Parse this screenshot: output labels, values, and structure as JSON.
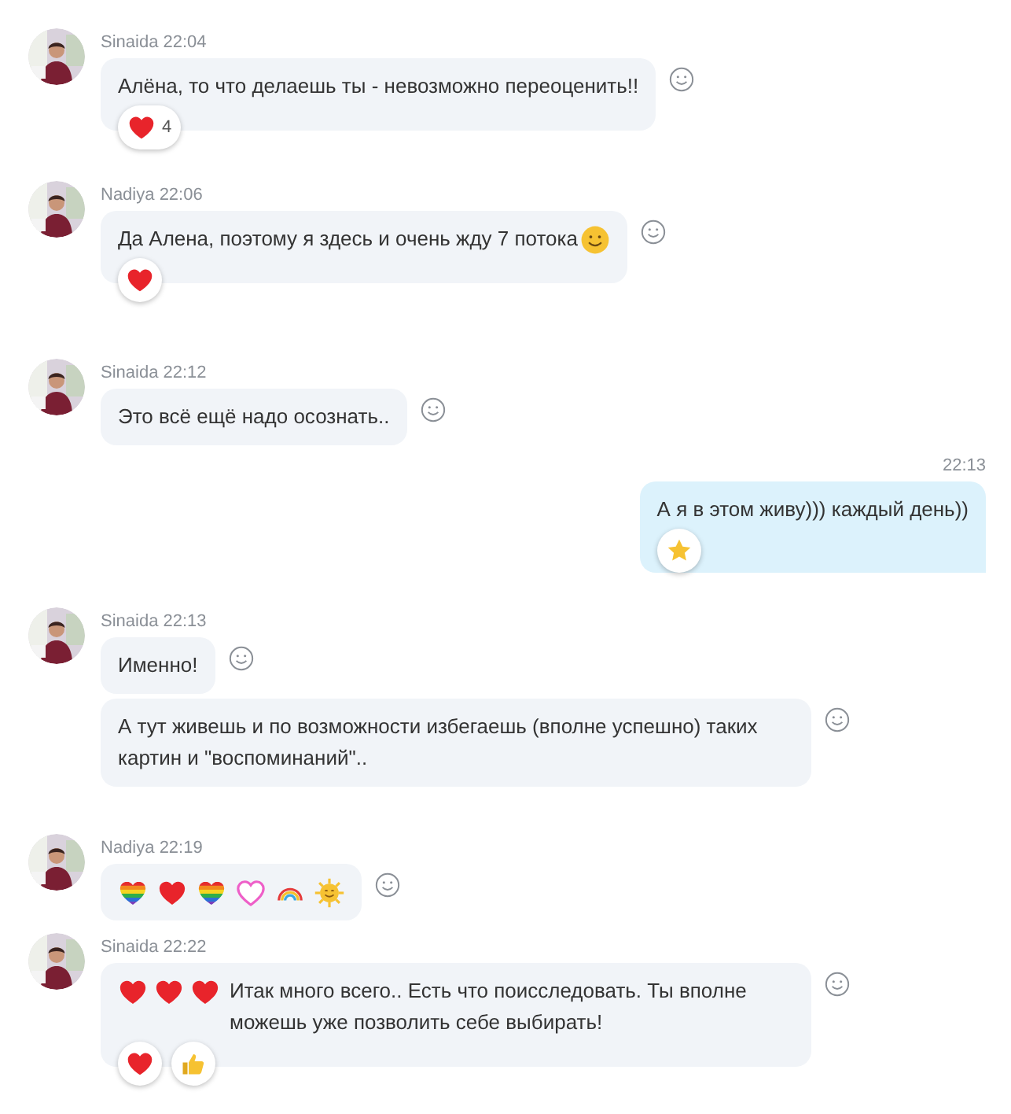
{
  "messages": [
    {
      "kind": "incoming",
      "author": "Sinaida",
      "time": "22:04",
      "avatar": {
        "kind": "picture"
      },
      "bubbles": [
        {
          "parts": [
            {
              "kind": "text",
              "text": "Алёна, то что делаешь ты - невозможно переоценить!!"
            }
          ],
          "reactions": [
            {
              "kind": "heart",
              "count": "4"
            }
          ]
        }
      ]
    },
    {
      "kind": "incoming",
      "author": "Nadiya",
      "time": "22:06",
      "avatar": {
        "kind": "picture"
      },
      "bubbles": [
        {
          "parts": [
            {
              "kind": "text",
              "text": "Да Алена,  поэтому я здесь и очень жду 7 потока"
            },
            {
              "kind": "smiley"
            }
          ],
          "reactions": [
            {
              "kind": "heart"
            }
          ]
        }
      ]
    },
    {
      "kind": "incoming",
      "author": "Sinaida",
      "time": "22:12",
      "avatar": {
        "kind": "picture"
      },
      "bubbles": [
        {
          "parts": [
            {
              "kind": "text",
              "text": "Это всё ещё надо осознать.."
            }
          ]
        }
      ]
    },
    {
      "kind": "outgoing",
      "time": "22:13",
      "bubbles": [
        {
          "parts": [
            {
              "kind": "text",
              "text": "А я в этом живу))) каждый день))"
            }
          ],
          "reactions": [
            {
              "kind": "star"
            }
          ]
        }
      ]
    },
    {
      "kind": "incoming",
      "author": "Sinaida",
      "time": "22:13",
      "avatar": {
        "kind": "picture"
      },
      "bubbles": [
        {
          "parts": [
            {
              "kind": "text",
              "text": "Именно!"
            }
          ]
        },
        {
          "parts": [
            {
              "kind": "text",
              "text": "А тут живешь и по возможности избегаешь (вполне успешно) таких картин и \"воспоминаний\".."
            }
          ]
        }
      ]
    },
    {
      "kind": "incoming",
      "author": "Nadiya",
      "time": "22:19",
      "avatar": {
        "kind": "picture"
      },
      "bubbles": [
        {
          "parts": [
            {
              "kind": "rainbow-heart"
            },
            {
              "kind": "heart"
            },
            {
              "kind": "rainbow-heart"
            },
            {
              "kind": "outline-heart"
            },
            {
              "kind": "rainbow"
            },
            {
              "kind": "sun"
            }
          ]
        }
      ]
    },
    {
      "kind": "incoming",
      "author": "Sinaida",
      "time": "22:22",
      "avatar": {
        "kind": "picture"
      },
      "bubbles": [
        {
          "parts": [
            {
              "kind": "heart"
            },
            {
              "kind": "heart"
            },
            {
              "kind": "heart"
            },
            {
              "kind": "text",
              "text": "Итак много всего.. Есть что поисследовать. Ты вполне можешь уже позволить себе выбирать!"
            }
          ],
          "reactions": [
            {
              "kind": "heart"
            },
            {
              "kind": "thumbs-up"
            }
          ]
        }
      ]
    }
  ]
}
